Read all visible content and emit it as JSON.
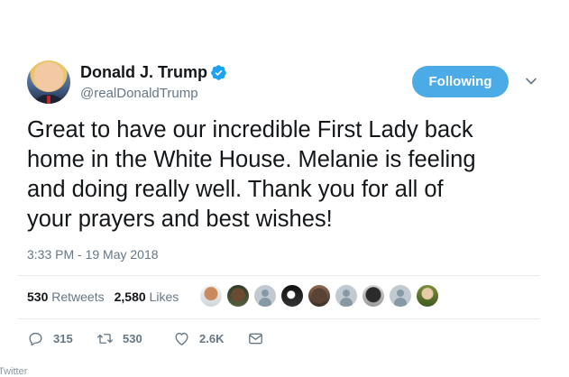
{
  "author": {
    "display_name": "Donald J. Trump",
    "handle": "@realDonaldTrump",
    "verified": true
  },
  "follow_button": {
    "label": "Following"
  },
  "tweet": {
    "lines": [
      "Great to have our incredible First Lady back",
      "home in the White House. Melanie is feeling",
      "and doing really well. Thank you for all of",
      "your prayers and best wishes!"
    ],
    "timestamp": "3:33 PM - 19 May 2018"
  },
  "stats": {
    "retweets": {
      "count": "530",
      "label": "Retweets"
    },
    "likes": {
      "count": "2,580",
      "label": "Likes"
    }
  },
  "actions": {
    "replies": "315",
    "retweets": "530",
    "likes": "2.6K"
  },
  "source": "Twitter",
  "colors": {
    "accent": "#4aabe7",
    "muted": "#657786",
    "text": "#14171a",
    "divider": "#e6ecf0"
  },
  "icons": [
    "verified-badge-icon",
    "chevron-down-icon",
    "reply-icon",
    "retweet-icon",
    "like-icon",
    "direct-message-icon"
  ]
}
